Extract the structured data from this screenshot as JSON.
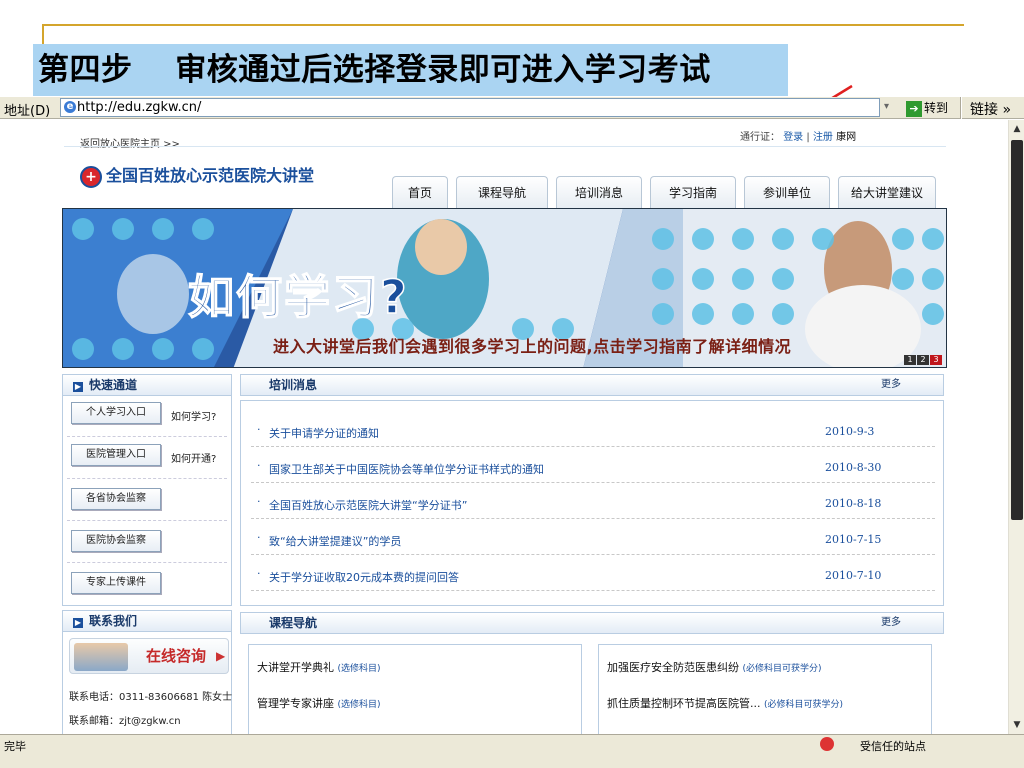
{
  "slide": {
    "title": "第四步　 审核通过后选择登录即可进入学习考试"
  },
  "browser": {
    "address_label": "地址(D)",
    "address_url": "http://edu.zgkw.cn/",
    "go_label": "转到",
    "links_label": "链接 »",
    "status_done": "完毕",
    "status_zone": "受信任的站点"
  },
  "site": {
    "top_link": "返回放心医院主页 >>",
    "login_prefix": "通行证：",
    "login": "登录",
    "register": "注册",
    "partner": "康网",
    "logo_text": "全国百姓放心示范医院大讲堂",
    "nav": [
      "首页",
      "课程导航",
      "培训消息",
      "学习指南",
      "参训单位",
      "给大讲堂建议"
    ],
    "banner": {
      "big_text": "如何学习?",
      "caption": "进入大讲堂后我们会遇到很多学习上的问题,点击学习指南了解详细情况",
      "pager": [
        "1",
        "2",
        "3"
      ]
    },
    "quick": {
      "title": "快速通道",
      "buttons": [
        {
          "label": "个人学习入口",
          "side": "如何学习?"
        },
        {
          "label": "医院管理入口",
          "side": "如何开通?"
        },
        {
          "label": "各省协会监察",
          "side": ""
        },
        {
          "label": "医院协会监察",
          "side": ""
        },
        {
          "label": "专家上传课件",
          "side": ""
        }
      ]
    },
    "contact": {
      "title": "联系我们",
      "consult": "在线咨询",
      "phone": "联系电话：0311-83606681 陈女士",
      "email": "联系邮箱：zjt@zgkw.cn"
    },
    "news": {
      "title": "培训消息",
      "more": "更多",
      "items": [
        {
          "title": "关于申请学分证的通知",
          "date": "2010-9-3"
        },
        {
          "title": "国家卫生部关于中国医院协会等单位学分证书样式的通知",
          "date": "2010-8-30"
        },
        {
          "title": "全国百姓放心示范医院大讲堂“学分证书”",
          "date": "2010-8-18"
        },
        {
          "title": "致“给大讲堂提建议”的学员",
          "date": "2010-7-15"
        },
        {
          "title": "关于学分证收取20元成本费的提问回答",
          "date": "2010-7-10"
        }
      ]
    },
    "courses": {
      "title": "课程导航",
      "more": "更多",
      "left": [
        {
          "name": "大讲堂开学典礼",
          "tag": "(选修科目)"
        },
        {
          "name": "管理学专家讲座",
          "tag": "(选修科目)"
        }
      ],
      "right": [
        {
          "name": "加强医疗安全防范医患纠纷",
          "tag": "(必修科目可获学分)"
        },
        {
          "name": "抓住质量控制环节提高医院管...",
          "tag": "(必修科目可获学分)"
        }
      ]
    }
  },
  "colors": {
    "title_bg": "#aad4f2",
    "accent_line": "#d4a52c",
    "link_blue": "#1a4f9c",
    "arrow_red": "#e02020"
  }
}
